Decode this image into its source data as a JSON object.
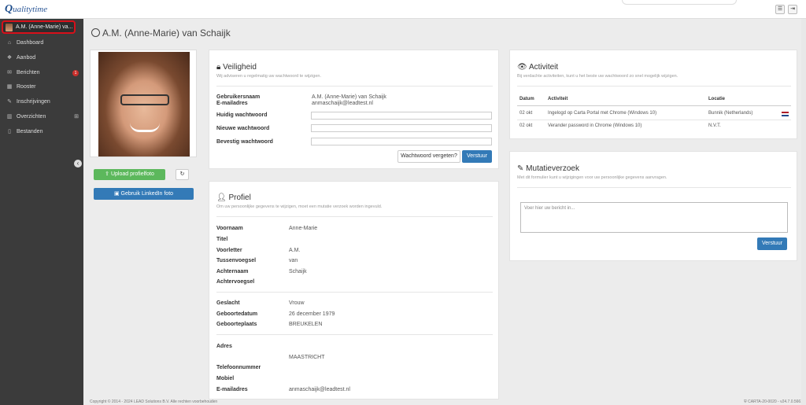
{
  "app": {
    "logo_q": "Q",
    "logo_rest": "ualitytime"
  },
  "topbar": {
    "menu_icon": "menu-icon",
    "logout_icon": "logout-icon"
  },
  "sidebar": {
    "user": "A.M. (Anne-Marie) va...",
    "items": [
      {
        "label": "Dashboard",
        "icon": "home-icon"
      },
      {
        "label": "Aanbod",
        "icon": "cubes-icon"
      },
      {
        "label": "Berichten",
        "icon": "chat-icon",
        "badge": "1"
      },
      {
        "label": "Rooster",
        "icon": "calendar-icon"
      },
      {
        "label": "Inschrijvingen",
        "icon": "edit-icon"
      },
      {
        "label": "Overzichten",
        "icon": "chart-icon",
        "expand": "⊞"
      },
      {
        "label": "Bestanden",
        "icon": "file-icon"
      }
    ]
  },
  "page": {
    "title": "A.M. (Anne-Marie) van Schaijk"
  },
  "photo": {
    "upload_label": "Upload profielfoto",
    "reset_label": "↻",
    "linkedin_label": "Gebruik LinkedIn foto"
  },
  "security": {
    "title": "Veiligheid",
    "subtitle": "Wij adviseren u regelmatig uw wachtwoord te wijzigen.",
    "username_label": "Gebruikersnaam",
    "username_value": "A.M. (Anne-Marie) van Schaijk",
    "email_label": "E-mailadres",
    "email_value": "anmaschaijk@leadtest.nl",
    "current_label": "Huidig wachtwoord",
    "new_label": "Nieuwe wachtwoord",
    "confirm_label": "Bevestig wachtwoord",
    "forgot_label": "Wachtwoord vergeten?",
    "submit_label": "Verstuur"
  },
  "profile": {
    "title": "Profiel",
    "subtitle": "Om uw persoonlijke gegevens te wijzigen, moet een mutatie verzoek worden ingevuld.",
    "fields": [
      {
        "label": "Voornaam",
        "value": "Anne-Marie"
      },
      {
        "label": "Titel",
        "value": ""
      },
      {
        "label": "Voorletter",
        "value": "A.M."
      },
      {
        "label": "Tussenvoegsel",
        "value": "van"
      },
      {
        "label": "Achternaam",
        "value": "Schaijk"
      },
      {
        "label": "Achtervoegsel",
        "value": ""
      },
      {
        "label": "Geslacht",
        "value": "Vrouw"
      },
      {
        "label": "Geboortedatum",
        "value": "26 december 1979"
      },
      {
        "label": "Geboorteplaats",
        "value": "BREUKELEN"
      },
      {
        "label": "Adres",
        "value": ""
      },
      {
        "label": "",
        "value": "MAASTRICHT"
      },
      {
        "label": "Telefoonnummer",
        "value": ""
      },
      {
        "label": "Mobiel",
        "value": ""
      },
      {
        "label": "E-mailadres",
        "value": "anmaschaijk@leadtest.nl"
      }
    ]
  },
  "activity": {
    "title": "Activiteit",
    "subtitle": "Bij verdachte activiteiten, kunt u het beste uw wachtwoord zo snel mogelijk wijzigen.",
    "headers": [
      "Datum",
      "Activiteit",
      "Locatie"
    ],
    "rows": [
      {
        "date": "02 okt",
        "activity": "Ingelogd op Carta Portal met Chrome (Windows 10)",
        "location": "Bunnik (Netherlands)",
        "flag": "nl-flag-icon"
      },
      {
        "date": "02 okt",
        "activity": "Verander password in Chrome (Windows 10)",
        "location": "N.V.T.",
        "flag": ""
      }
    ]
  },
  "mutation": {
    "title": "Mutatieverzoek",
    "subtitle": "Met dit formulier kunt u wijzigingen voor uw persoonlijke gegevens aanvragen.",
    "placeholder": "Voer hier uw bericht in...",
    "submit_label": "Verstuur"
  },
  "footer": {
    "copyright": "Copyright © 2014 - 2024 LEAD Solutions B.V. Alle rechten voorbehouden",
    "version": "CARTA-20-0020 - v24.7.0.5661"
  },
  "colors": {
    "sidebar": "#3b3b3b",
    "accent_blue": "#337ab7",
    "accent_green": "#5cb85c",
    "badge_red": "#c9302c",
    "highlight": "#d9101a"
  }
}
